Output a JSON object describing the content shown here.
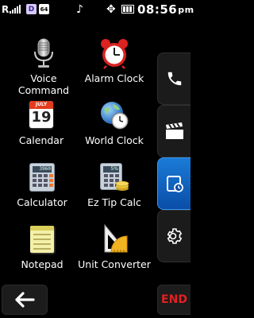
{
  "status_bar": {
    "signal_label": "R",
    "badge_d": "D",
    "badge_64": "64",
    "time": "08:56",
    "ampm": "pm"
  },
  "apps": [
    {
      "label": "Voice Command",
      "icon": "microphone-icon"
    },
    {
      "label": "Alarm Clock",
      "icon": "alarm-clock-icon"
    },
    {
      "label": "Calendar",
      "icon": "calendar-icon",
      "calendar_month": "JULY",
      "calendar_day": "19"
    },
    {
      "label": "World Clock",
      "icon": "world-clock-icon"
    },
    {
      "label": "Calculator",
      "icon": "calculator-icon",
      "display": "3960"
    },
    {
      "label": "Ez Tip Calc",
      "icon": "tip-calculator-icon",
      "display": "5%"
    },
    {
      "label": "Notepad",
      "icon": "notepad-icon"
    },
    {
      "label": "Unit Converter",
      "icon": "unit-converter-icon"
    }
  ],
  "dock": [
    {
      "icon": "phone-icon",
      "active": false
    },
    {
      "icon": "clapperboard-icon",
      "active": false
    },
    {
      "icon": "tools-icon",
      "active": true
    },
    {
      "icon": "settings-gear-icon",
      "active": false
    }
  ],
  "bottom_bar": {
    "back_icon": "back-arrow-icon",
    "end_label": "END"
  },
  "colors": {
    "background": "#000000",
    "active_dock": "#1a7bd6",
    "end_text": "#e32020"
  }
}
